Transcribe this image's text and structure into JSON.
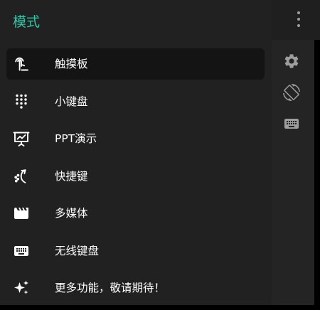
{
  "drawer": {
    "title": "模式",
    "items": [
      {
        "label": "触摸板",
        "icon": "touch-gesture-icon",
        "active": true
      },
      {
        "label": "小键盘",
        "icon": "dialpad-icon",
        "active": false
      },
      {
        "label": "PPT演示",
        "icon": "presentation-icon",
        "active": false
      },
      {
        "label": "快捷键",
        "icon": "shortcut-gesture-icon",
        "active": false
      },
      {
        "label": "多媒体",
        "icon": "media-clapperboard-icon",
        "active": false
      },
      {
        "label": "无线键盘",
        "icon": "keyboard-icon",
        "active": false
      },
      {
        "label": "更多功能，敬请期待！",
        "icon": "sparkle-icon",
        "active": false
      }
    ]
  },
  "app": {
    "toolbar_icons": [
      "more-vert-icon"
    ],
    "side_icons": [
      "gear-icon",
      "screen-rotation-icon",
      "keyboard-icon"
    ]
  },
  "colors": {
    "accent": "#2ec7a9",
    "drawer_bg": "#212121",
    "active_item_bg": "#141414",
    "icon_gray": "#9e9e9e"
  }
}
